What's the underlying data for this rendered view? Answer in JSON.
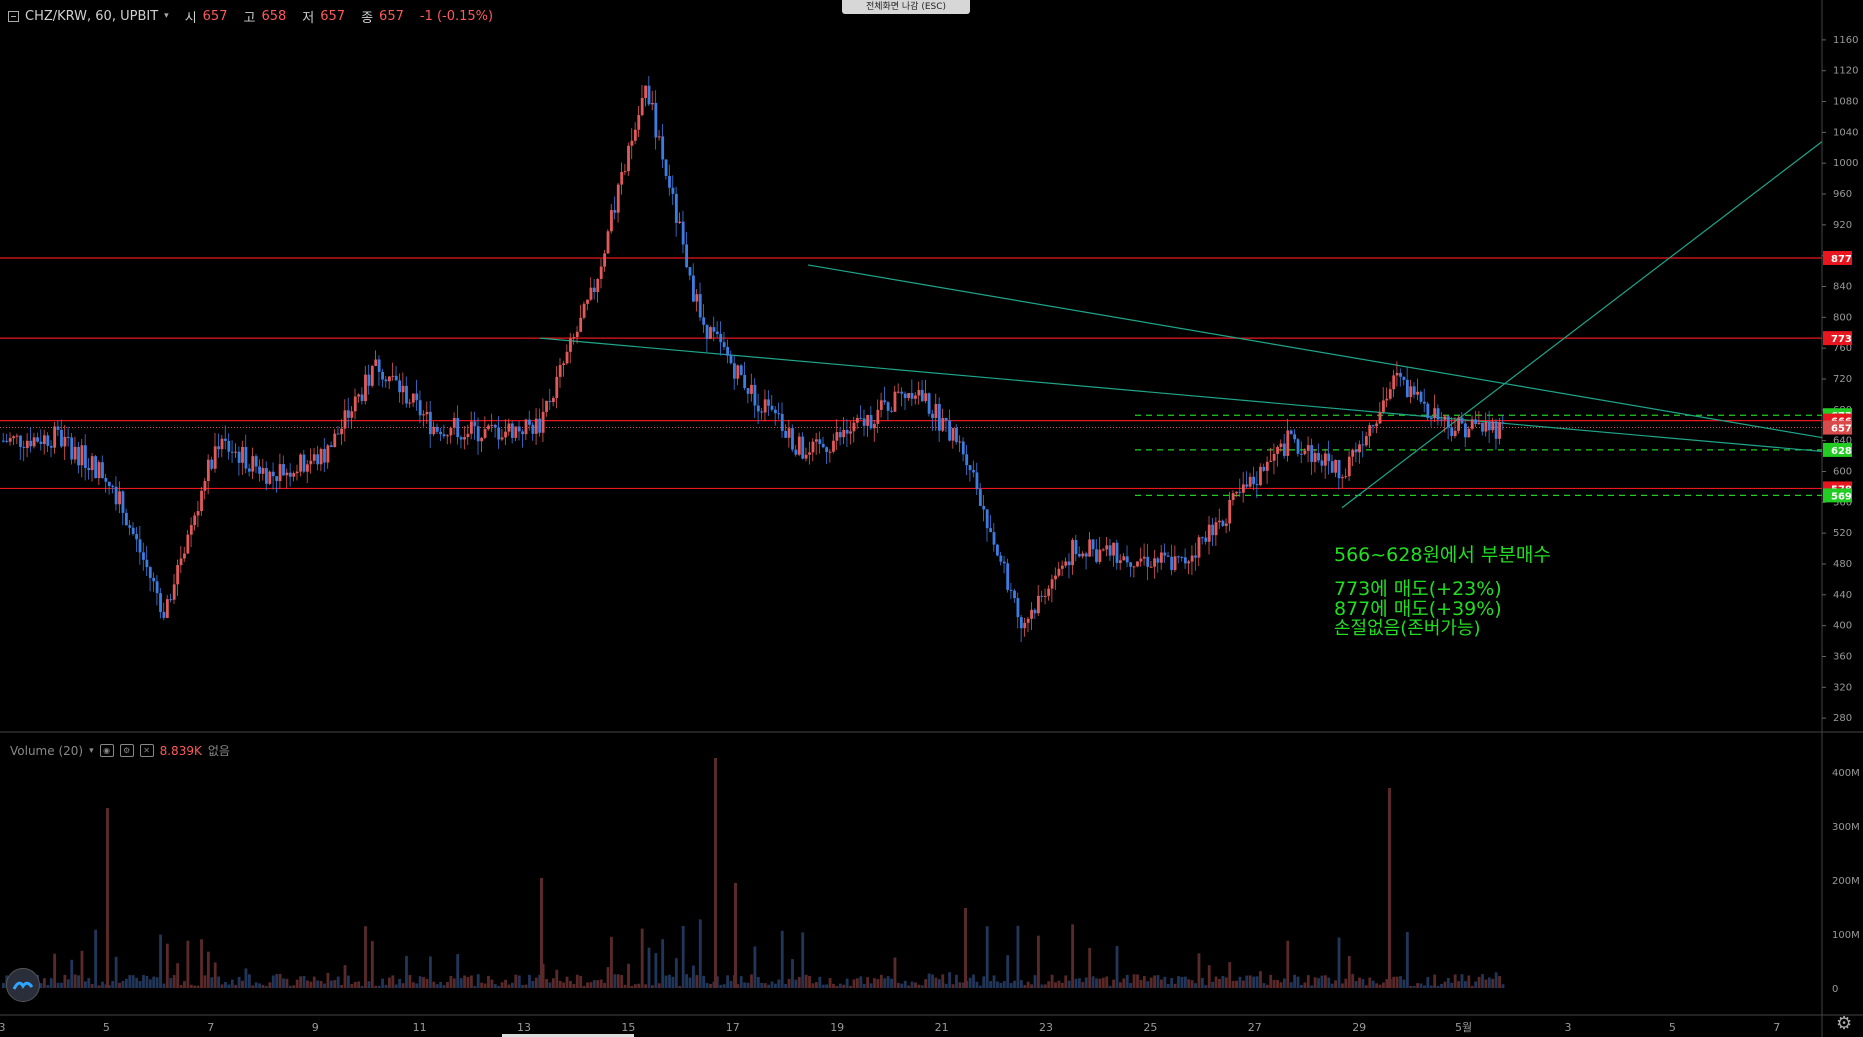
{
  "header": {
    "collapse_icon": "minus-square-icon",
    "symbol": "CHZ/KRW, 60, UPBIT",
    "open_label": "시",
    "open_value": "657",
    "high_label": "고",
    "high_value": "658",
    "low_label": "저",
    "low_value": "657",
    "close_label": "종",
    "close_value": "657",
    "change": "-1 (-0.15%)"
  },
  "fullscreen_exit": "전체화면 나감 (ESC)",
  "price_axis": {
    "ticks": [
      "1160",
      "1120",
      "1080",
      "1040",
      "1000",
      "960",
      "920",
      "880",
      "840",
      "800",
      "760",
      "720",
      "680",
      "640",
      "600",
      "560",
      "520",
      "480",
      "440",
      "400",
      "360",
      "320",
      "280"
    ],
    "range": [
      262,
      1178
    ]
  },
  "price_tags": [
    {
      "label": "877",
      "price": 877,
      "color": "#e8171f"
    },
    {
      "label": "773",
      "price": 773,
      "color": "#e8171f"
    },
    {
      "label": "673",
      "price": 673,
      "color": "#22cc22"
    },
    {
      "label": "666",
      "price": 666,
      "color": "#e8171f"
    },
    {
      "label": "657",
      "price": 657,
      "color": "#d94a4a"
    },
    {
      "label": "628",
      "price": 628,
      "color": "#22cc22"
    },
    {
      "label": "578",
      "price": 578,
      "color": "#e8171f"
    },
    {
      "label": "569",
      "price": 569,
      "color": "#22cc22"
    }
  ],
  "horizontal_lines": [
    {
      "price": 877,
      "color": "#e8171f",
      "style": "solid"
    },
    {
      "price": 773,
      "color": "#e8171f",
      "style": "solid"
    },
    {
      "price": 666,
      "color": "#e8171f",
      "style": "solid"
    },
    {
      "price": 578,
      "color": "#e8171f",
      "style": "solid"
    },
    {
      "price": 673,
      "color": "#22cc22",
      "style": "dashed"
    },
    {
      "price": 628,
      "color": "#22cc22",
      "style": "dashed"
    },
    {
      "price": 569,
      "color": "#22cc22",
      "style": "dashed"
    }
  ],
  "time_axis": {
    "labels": [
      "3",
      "5",
      "7",
      "9",
      "11",
      "13",
      "15",
      "17",
      "19",
      "21",
      "23",
      "25",
      "27",
      "29",
      "5월",
      "3",
      "5",
      "7"
    ]
  },
  "volume": {
    "title": "Volume (20)",
    "value": "8.839K",
    "na": "없음",
    "ticks": [
      "400M",
      "300M",
      "200M",
      "100M",
      "0"
    ]
  },
  "annotation": {
    "buy": "566~628원에서 부분매수",
    "sell1": "773에 매도(+23%)",
    "sell2": "877에 매도(+39%)",
    "stop": "손절없음(존버가능)"
  },
  "chart_data": {
    "type": "candlestick",
    "title": "CHZ/KRW, 60, UPBIT",
    "interval": "60",
    "ylim": [
      262,
      1178
    ],
    "key_prices": [
      {
        "x": "start",
        "price": 640
      },
      {
        "x": "5",
        "price": 645
      },
      {
        "x": "7",
        "price": 590
      },
      {
        "x": "8",
        "price": 420
      },
      {
        "x": "9",
        "price": 640
      },
      {
        "x": "11",
        "price": 595
      },
      {
        "x": "13",
        "price": 620
      },
      {
        "x": "13.5",
        "price": 740
      },
      {
        "x": "14",
        "price": 660
      },
      {
        "x": "15",
        "price": 650
      },
      {
        "x": "16",
        "price": 660
      },
      {
        "x": "16.5",
        "price": 830
      },
      {
        "x": "17",
        "price": 1100
      },
      {
        "x": "18",
        "price": 800
      },
      {
        "x": "19",
        "price": 700
      },
      {
        "x": "20",
        "price": 620
      },
      {
        "x": "21",
        "price": 660
      },
      {
        "x": "22",
        "price": 710
      },
      {
        "x": "22.5",
        "price": 620
      },
      {
        "x": "23",
        "price": 400
      },
      {
        "x": "24",
        "price": 500
      },
      {
        "x": "25",
        "price": 490
      },
      {
        "x": "26",
        "price": 480
      },
      {
        "x": "27",
        "price": 560
      },
      {
        "x": "28",
        "price": 640
      },
      {
        "x": "29",
        "price": 600
      },
      {
        "x": "29.5",
        "price": 720
      },
      {
        "x": "30",
        "price": 660
      },
      {
        "x": "last",
        "price": 657
      }
    ]
  }
}
